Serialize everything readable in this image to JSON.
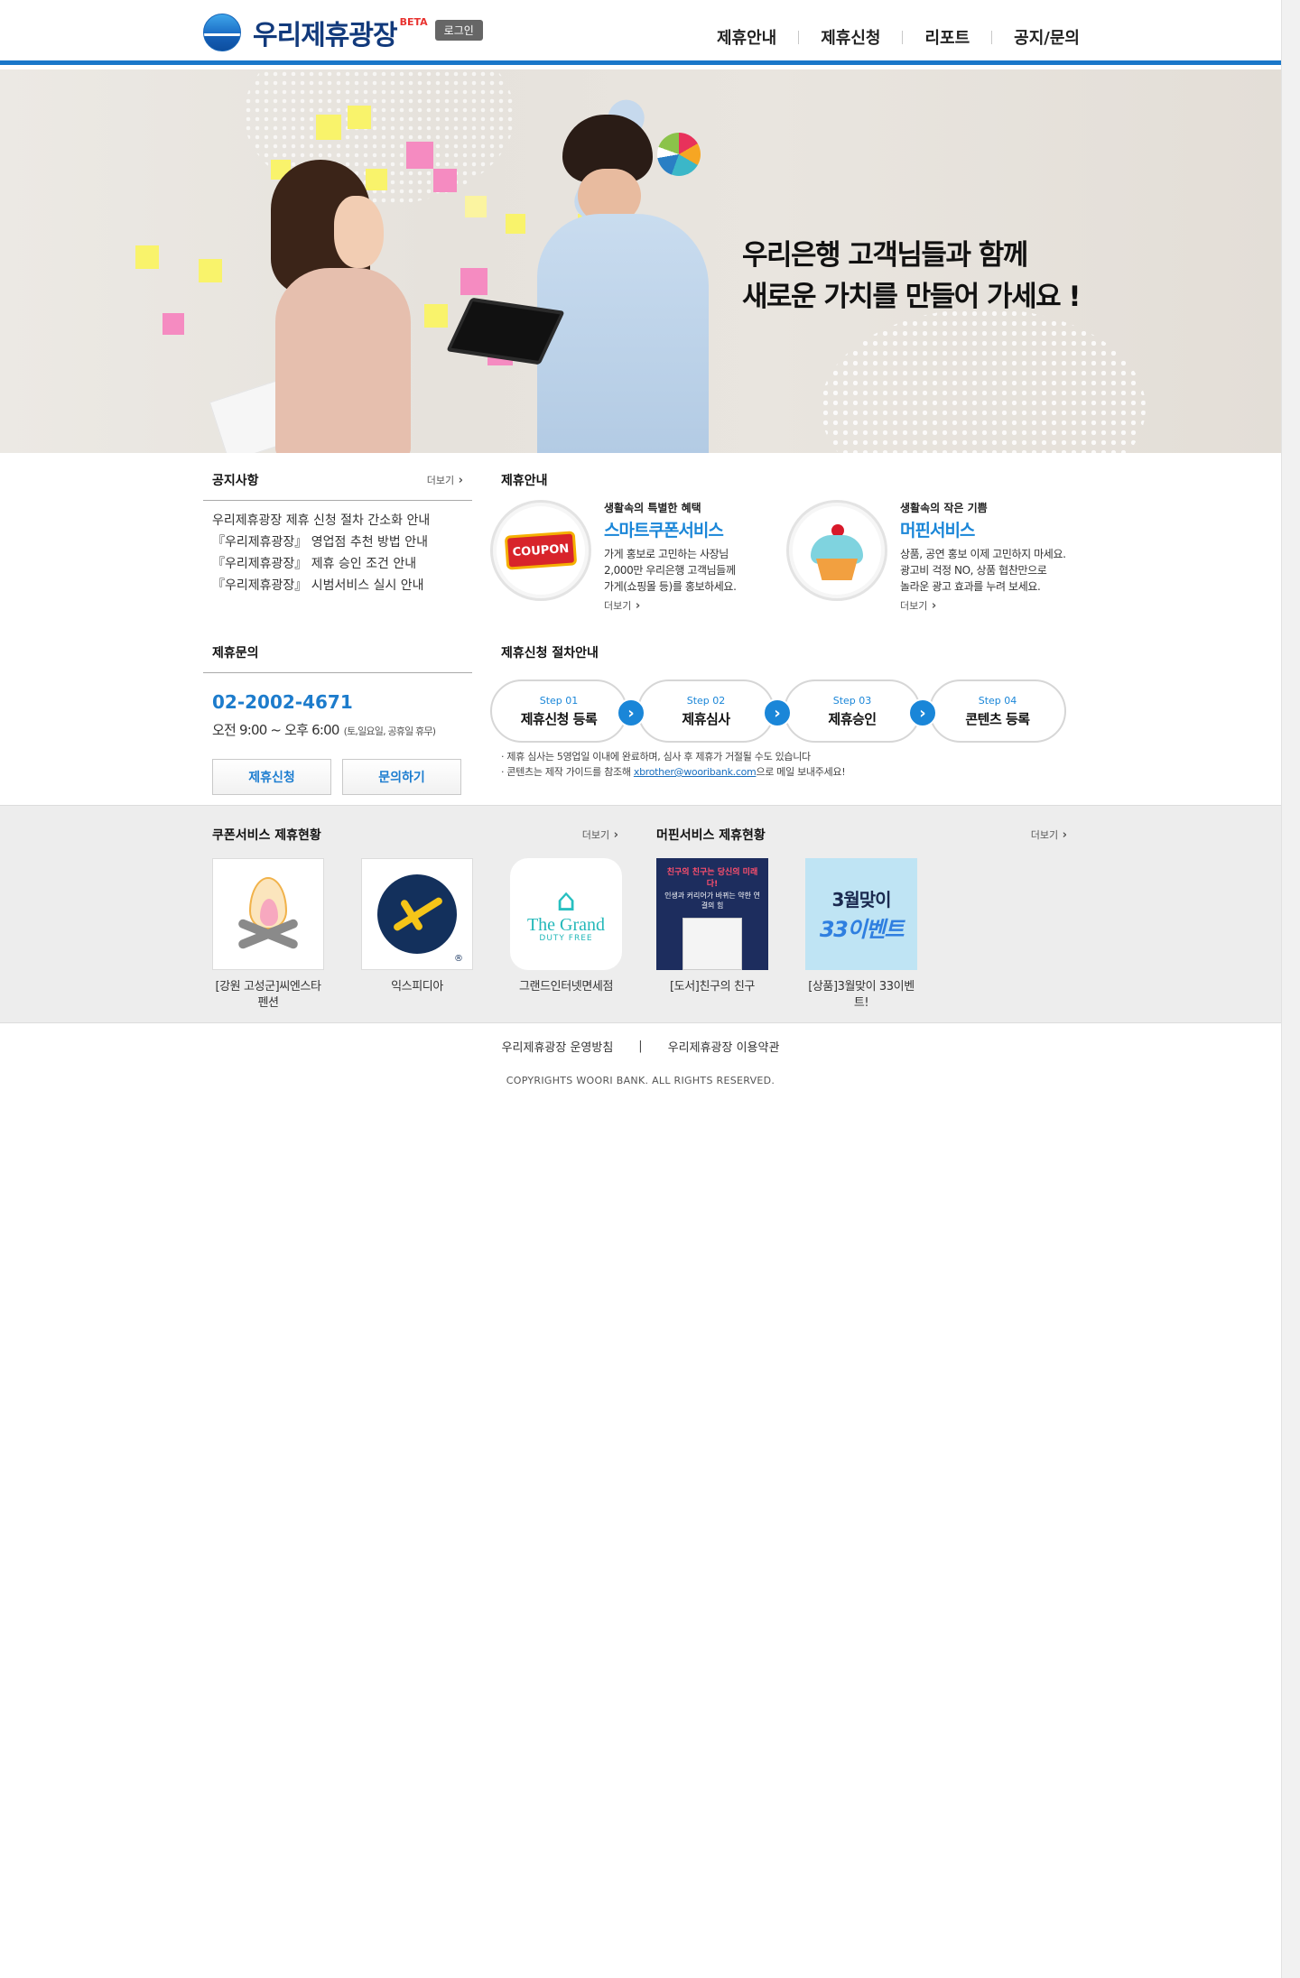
{
  "header": {
    "logo_text": "우리제휴광장",
    "beta": "BETA",
    "login": "로그인",
    "nav": [
      "제휴안내",
      "제휴신청",
      "리포트",
      "공지/문의"
    ]
  },
  "hero": {
    "line1": "우리은행 고객님들과 함께",
    "line2": "새로운 가치를 만들어 가세요 !"
  },
  "notice": {
    "title": "공지사항",
    "more": "더보기",
    "items": [
      "우리제휴광장 제휴 신청 절차 간소화 안내",
      "『우리제휴광장』 영업점 추천 방법 안내",
      "『우리제휴광장』 제휴 승인 조건 안내",
      "『우리제휴광장』 시범서비스 실시 안내"
    ]
  },
  "guide": {
    "title": "제휴안내",
    "services": [
      {
        "sub": "생활속의 특별한 혜택",
        "name": "스마트쿠폰서비스",
        "desc": [
          "가게 홍보로 고민하는 사장님",
          "2,000만 우리은행 고객님들께",
          "가게(쇼핑몰 등)를 홍보하세요."
        ],
        "more": "더보기",
        "icon": "coupon-icon",
        "icon_text": "COUPON"
      },
      {
        "sub": "생활속의 작은 기쁨",
        "name": "머핀서비스",
        "desc": [
          "상품, 공연 홍보 이제 고민하지 마세요.",
          "광고비 걱정 NO, 상품 협찬만으로",
          "놀라운 광고 효과를 누려 보세요."
        ],
        "more": "더보기",
        "icon": "cupcake-icon"
      }
    ]
  },
  "inquiry": {
    "title": "제휴문의",
    "phone": "02-2002-4671",
    "hours": "오전 9:00 ~ 오후 6:00",
    "hours_note": "(토,일요일, 공휴일 휴무)",
    "apply_button": "제휴신청",
    "ask_button": "문의하기"
  },
  "procedure": {
    "title": "제휴신청 절차안내",
    "steps": [
      {
        "no": "Step 01",
        "name": "제휴신청 등록"
      },
      {
        "no": "Step 02",
        "name": "제휴심사"
      },
      {
        "no": "Step 03",
        "name": "제휴승인"
      },
      {
        "no": "Step 04",
        "name": "콘텐츠 등록"
      }
    ],
    "note1": "제휴 심사는 5영업일 이내에 완료하며, 심사 후 제휴가 거절될 수도 있습니다",
    "note2_pre": "콘텐츠는 제작 가이드를 참조해 ",
    "note2_email": "xbrother@wooribank.com",
    "note2_post": "으로 메일 보내주세요!"
  },
  "partners": {
    "coupon": {
      "title": "쿠폰서비스 제휴현황",
      "more": "더보기",
      "items": [
        "[강원 고성군]씨엔스타 펜션",
        "익스피디아",
        "그랜드인터넷면세점"
      ]
    },
    "muffin": {
      "title": "머핀서비스 제휴현황",
      "more": "더보기",
      "items": [
        "[도서]친구의 친구",
        "[상품]3월맞이 33이벤트!"
      ]
    },
    "thumb_text": {
      "grand_name": "The Grand",
      "grand_sub": "DUTY FREE",
      "book_top": "친구의 친구는 당신의 미래다!",
      "book_sub": "인생과 커리어가 바뀌는 약한 연결의 힘",
      "event_line1": "3월맞이",
      "event_line2": "33이벤트",
      "expedia_reg": "®"
    }
  },
  "footer": {
    "policy": "우리제휴광장 운영방침",
    "sep": "|",
    "terms": "우리제휴광장 이용약관",
    "copyright": "COPYRIGHTS WOORI BANK. ALL RIGHTS RESERVED."
  },
  "colors": {
    "brand_blue": "#1a77c9",
    "accent_blue": "#1a86d8",
    "navy": "#123a7c"
  }
}
